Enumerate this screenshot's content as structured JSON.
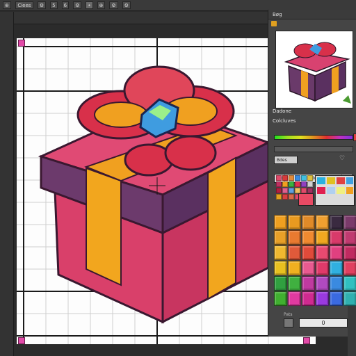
{
  "toolbar": {
    "items": [
      "⊕",
      "Ciees",
      "⚙",
      "5",
      "6",
      "⚙",
      "•",
      "⊕",
      "⚙",
      "⚙"
    ]
  },
  "panel": {
    "title": "Bøg",
    "section_label": "Dadone",
    "sub_label": "Colcluves",
    "field_label": "Bdes",
    "tabs": [
      "80",
      "Edittone",
      "80"
    ],
    "bottom_label": "Pats",
    "bottom_value": "0"
  },
  "colors": {
    "box_pink": "#e0406a",
    "box_dark": "#6a3a6a",
    "ribbon_orange": "#f0a020",
    "bow_red": "#d8304a",
    "gem": "#40a0e0",
    "corner_marker": "#e24aa8"
  }
}
